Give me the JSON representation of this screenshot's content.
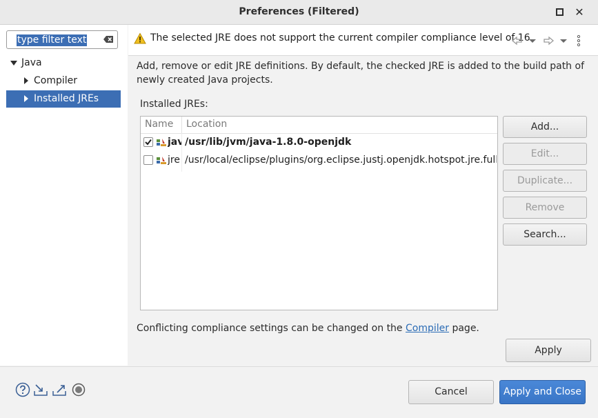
{
  "window": {
    "title": "Preferences (Filtered)"
  },
  "filter": {
    "placeholder": "type filter text",
    "selected_text": "type filter text"
  },
  "tree": {
    "items": [
      {
        "label": "Java",
        "expanded": true
      },
      {
        "label": "Compiler",
        "expanded": false
      },
      {
        "label": "Installed JREs",
        "expanded": false,
        "selected": true
      }
    ]
  },
  "message": {
    "text": "The selected JRE does not support the current compiler compliance level of 16"
  },
  "page": {
    "description": "Add, remove or edit JRE definitions. By default, the checked JRE is added to the build path of newly created Java projects.",
    "installed_label": "Installed JREs:",
    "table": {
      "columns": [
        "Name",
        "Location"
      ],
      "rows": [
        {
          "name": "jav",
          "location": "/usr/lib/jvm/java-1.8.0-openjdk",
          "checked": true,
          "bold": true
        },
        {
          "name": "jre",
          "location": "/usr/local/eclipse/plugins/org.eclipse.justj.openjdk.hotspot.jre.full.linux.",
          "checked": false,
          "bold": false
        }
      ]
    },
    "buttons": {
      "add": "Add...",
      "edit": "Edit...",
      "duplicate": "Duplicate...",
      "remove": "Remove",
      "search": "Search..."
    },
    "conflict_prefix": "Conflicting compliance settings can be changed on the ",
    "conflict_link": "Compiler",
    "conflict_suffix": " page.",
    "apply": "Apply"
  },
  "footer": {
    "cancel": "Cancel",
    "apply_close": "Apply and Close"
  },
  "colors": {
    "accent": "#3c6eb4",
    "primary_button": "#3975c6",
    "link": "#2a6bb5",
    "warning": "#f0c020"
  }
}
